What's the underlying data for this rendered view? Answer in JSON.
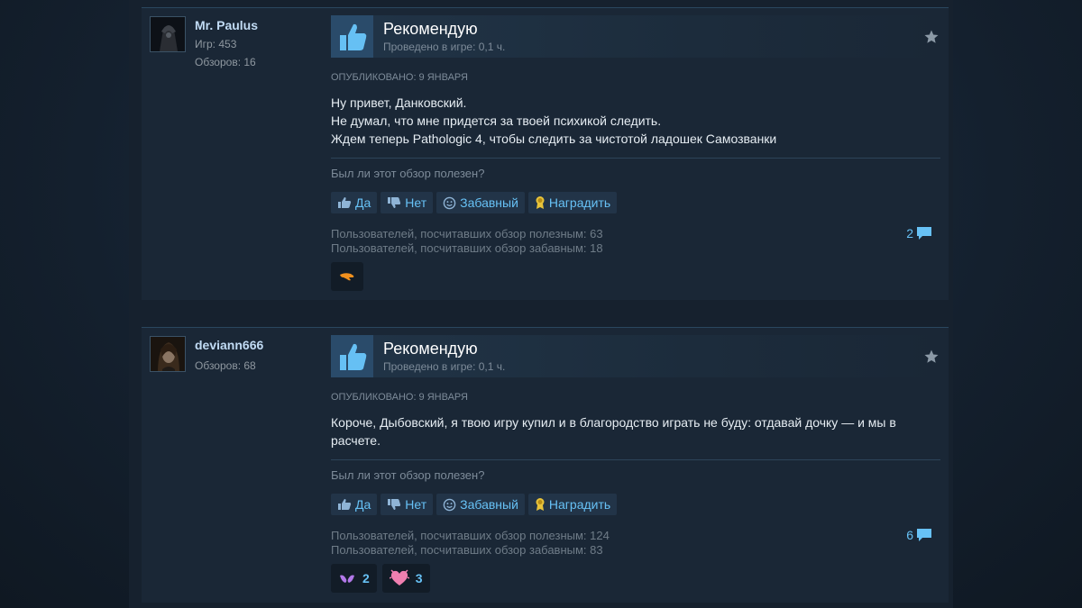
{
  "reviews": [
    {
      "author": {
        "name": "Mr. Paulus",
        "stats": [
          "Игр: 453",
          "Обзоров: 16"
        ]
      },
      "verdict": "Рекомендую",
      "hours": "Проведено в игре: 0,1 ч.",
      "posted": "Опубликовано: 9 января",
      "text": [
        "Ну привет, Данковский.",
        "Не думал, что мне придется за твоей психикой следить.",
        "Ждем теперь Pathologic 4, чтобы следить за чистотой ладошек Самозванки"
      ],
      "helpful_question": "Был ли этот обзор полезен?",
      "buttons": {
        "yes": "Да",
        "no": "Нет",
        "funny": "Забавный",
        "award": "Наградить"
      },
      "counts": {
        "helpful": "Пользователей, посчитавших обзор полезным: 63",
        "funny": "Пользователей, посчитавших обзор забавным: 18"
      },
      "comments": "2",
      "reactions": [
        {
          "icon": "orange-hand-icon",
          "count": ""
        }
      ]
    },
    {
      "author": {
        "name": "deviann666",
        "stats": [
          "Обзоров: 68"
        ]
      },
      "verdict": "Рекомендую",
      "hours": "Проведено в игре: 0,1 ч.",
      "posted": "Опубликовано: 9 января",
      "text": [
        "Короче, Дыбовский, я твою игру купил и в благородство играть не буду: отдавай дочку — и мы в расчете."
      ],
      "helpful_question": "Был ли этот обзор полезен?",
      "buttons": {
        "yes": "Да",
        "no": "Нет",
        "funny": "Забавный",
        "award": "Наградить"
      },
      "counts": {
        "helpful": "Пользователей, посчитавших обзор полезным: 124",
        "funny": "Пользователей, посчитавших обзор забавным: 83"
      },
      "comments": "6",
      "reactions": [
        {
          "icon": "purple-heart-hands-icon",
          "count": "2"
        },
        {
          "icon": "pink-heart-icon",
          "count": "3"
        }
      ]
    }
  ],
  "colors": {
    "accent": "#67c1f5",
    "thumb_blue": "#5ab3ef",
    "panel": "#1a2736",
    "text": "#e6edf3",
    "muted": "#7d8b99"
  }
}
